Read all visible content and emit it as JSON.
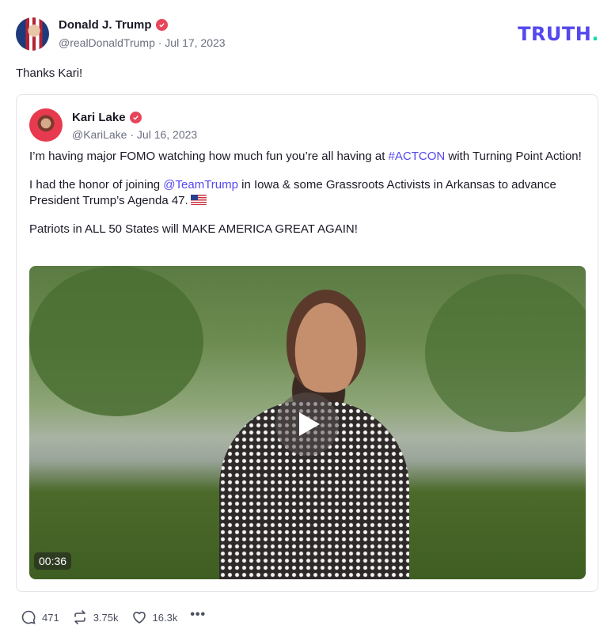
{
  "post": {
    "author_name": "Donald J. Trump",
    "handle_date": "@realDonaldTrump · Jul 17, 2023",
    "text": "Thanks Kari!"
  },
  "brand": {
    "logo_text": "TRUTH",
    "logo_dot": ".",
    "accent": "#5448ee",
    "dot_color": "#17d9b0"
  },
  "quote": {
    "author_name": "Kari Lake",
    "handle_date": "@KariLake · Jul 16, 2023",
    "line1_pre": "I’m having major FOMO watching how much fun you’re all having at ",
    "line1_tag": "#ACTCON",
    "line1_post": " with Turning Point Action!",
    "line2_pre": "I had the honor of joining ",
    "line2_mention": "@TeamTrump",
    "line2_post": " in Iowa & some Grassroots Activists in Arkansas to advance President Trump’s Agenda 47.",
    "line3": "Patriots in ALL 50 States will MAKE AMERICA GREAT AGAIN!",
    "video_duration": "00:36"
  },
  "actions": {
    "replies": "471",
    "retruths": "3.75k",
    "likes": "16.3k",
    "more": "•••"
  },
  "icons": [
    "verified-icon",
    "play-icon",
    "reply-icon",
    "retruth-icon",
    "like-icon",
    "more-icon",
    "us-flag-icon"
  ]
}
